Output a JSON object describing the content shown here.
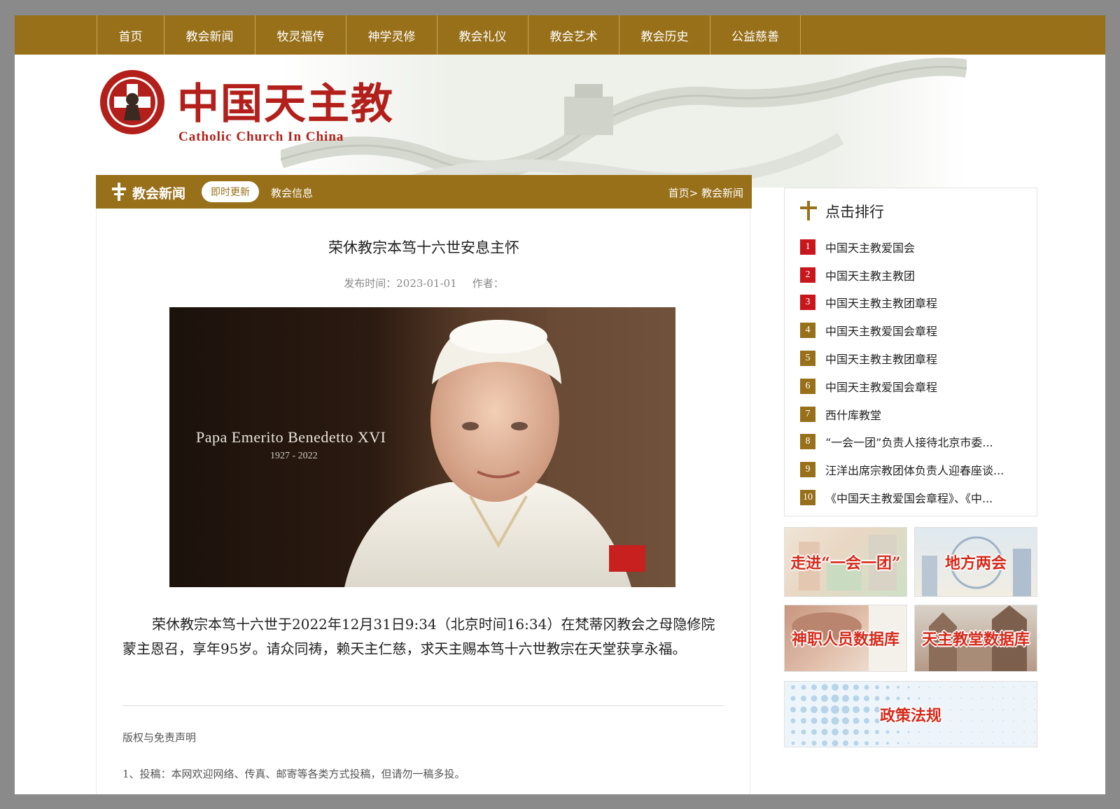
{
  "nav": {
    "items": [
      {
        "label": "首页",
        "width": 96
      },
      {
        "label": "教会新闻",
        "width": 130
      },
      {
        "label": "牧灵福传",
        "width": 130
      },
      {
        "label": "神学灵修",
        "width": 130
      },
      {
        "label": "教会礼仪",
        "width": 130
      },
      {
        "label": "教会艺术",
        "width": 130
      },
      {
        "label": "教会历史",
        "width": 130
      },
      {
        "label": "公益慈善",
        "width": 130
      }
    ]
  },
  "header": {
    "logo_cn": "中国天主教",
    "logo_en": "Catholic Church In China"
  },
  "section": {
    "title": "教会新闻",
    "active_tab": "即时更新",
    "tab2": "教会信息",
    "breadcrumb_home": "首页>",
    "breadcrumb_current": " 教会新闻"
  },
  "article": {
    "title": "荣休教宗本笃十六世安息主怀",
    "published": "发布时间：2023-01-01",
    "author": "作者：",
    "photo_caption": "Papa Emerito Benedetto XVI",
    "photo_years": "1927 - 2022",
    "body": "荣休教宗本笃十六世于2022年12月31日9:34（北京时间16:34）在梵蒂冈教会之母隐修院蒙主恩召，享年95岁。请众同祷，赖天主仁慈，求天主赐本笃十六世教宗在天堂获享永福。",
    "copyright_title": "版权与免责声明",
    "copyright_item1": "1、投稿：本网欢迎网络、传真、邮寄等各类方式投稿，但请勿一稿多投。"
  },
  "sidebar": {
    "rank_title": "点击排行",
    "rank_items": [
      {
        "num": "1",
        "text": "中国天主教爱国会",
        "color": "#c8161d"
      },
      {
        "num": "2",
        "text": "中国天主教主教团",
        "color": "#c8161d"
      },
      {
        "num": "3",
        "text": "中国天主教主教团章程",
        "color": "#c8161d"
      },
      {
        "num": "4",
        "text": "中国天主教爱国会章程",
        "color": "#98701a"
      },
      {
        "num": "5",
        "text": "中国天主教主教团章程",
        "color": "#98701a"
      },
      {
        "num": "6",
        "text": "中国天主教爱国会章程",
        "color": "#98701a"
      },
      {
        "num": "7",
        "text": "西什库教堂",
        "color": "#98701a"
      },
      {
        "num": "8",
        "text": "“一会一团”负责人接待北京市委...",
        "color": "#98701a"
      },
      {
        "num": "9",
        "text": "汪洋出席宗教团体负责人迎春座谈...",
        "color": "#98701a"
      },
      {
        "num": "10",
        "text": "《中国天主教爱国会章程》、《中...",
        "color": "#98701a"
      }
    ],
    "promos": [
      {
        "label": "走进“一会一团”"
      },
      {
        "label": "地方两会"
      },
      {
        "label": "神职人员数据库"
      },
      {
        "label": "天主教堂数据库"
      },
      {
        "label": "政策法规"
      }
    ]
  },
  "colors": {
    "brand": "#98701a",
    "rank_top": "#c8161d",
    "logo_red": "#b3201b"
  }
}
